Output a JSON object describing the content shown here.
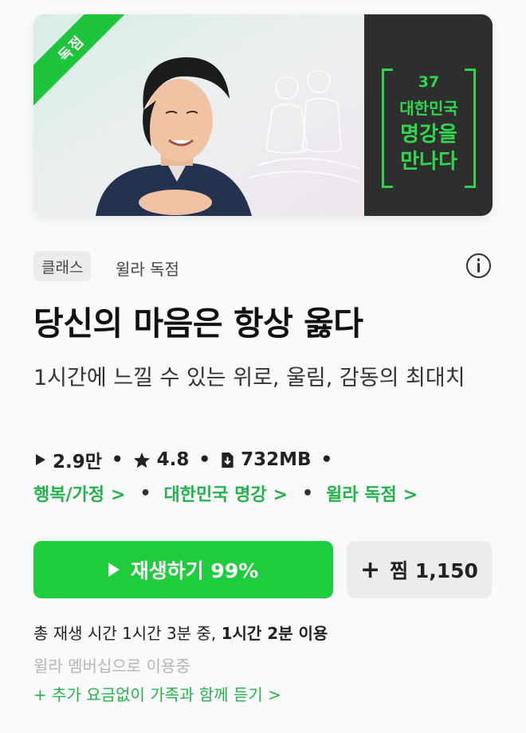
{
  "banner": {
    "ribbon_label": "독점",
    "series_number": "37",
    "series_line1": "대한민국",
    "series_line2": "명강을",
    "series_line3": "만나다"
  },
  "meta": {
    "type_chip": "클래스",
    "label": "윌라 독점"
  },
  "title": "당신의 마음은 항상 옳다",
  "subtitle": "1시간에 느낄 수 있는 위로, 울림, 감동의 최대치",
  "stats": {
    "plays": "2.9만",
    "rating": "4.8",
    "size": "732MB",
    "separator": "•"
  },
  "tags": [
    {
      "label": "행복/가정"
    },
    {
      "label": "대한민국 명강"
    },
    {
      "label": "윌라 독점"
    }
  ],
  "tag_chevron": ">",
  "buttons": {
    "play_label": "재생하기 99%",
    "save_label": "찜 1,150",
    "save_plus": "+"
  },
  "footer": {
    "total_prefix": "총 재생 시간 1시간 3분 중, ",
    "total_used": "1시간 2분 이용",
    "membership": "윌라 멤버십으로 이용중",
    "family": "+ 추가 요금없이 가족과 함께 듣기 >"
  },
  "colors": {
    "accent_green": "#1fcc3d",
    "tag_green": "#22b34a",
    "banner_dark": "#2e2e2e"
  },
  "icons": {
    "plays": "play-icon",
    "rating": "star-icon",
    "size": "download-file-icon",
    "info": "info-icon"
  }
}
